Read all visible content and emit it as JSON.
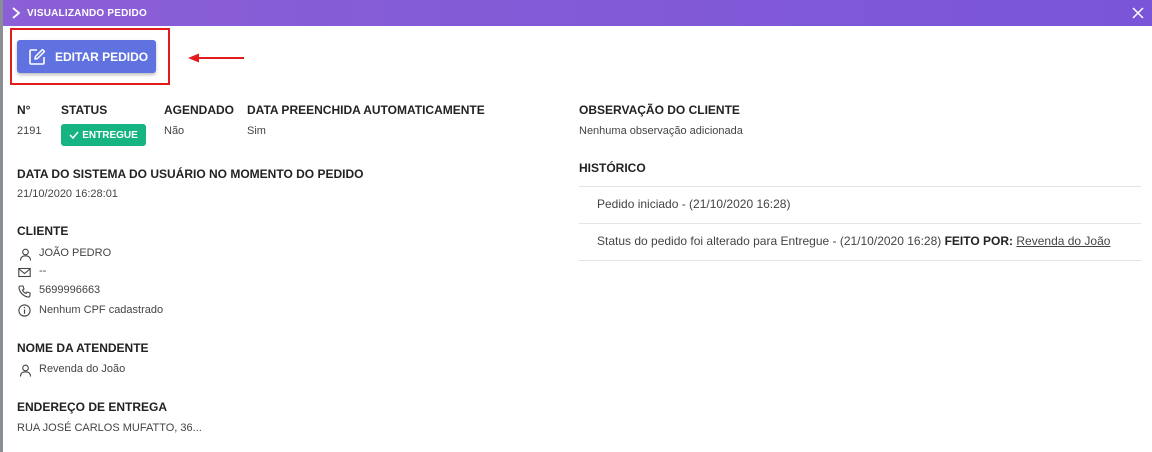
{
  "header": {
    "title": "VISUALIZANDO PEDIDO"
  },
  "toolbar": {
    "edit_label": "EDITAR PEDIDO"
  },
  "order": {
    "number_label": "N°",
    "number": "2191",
    "status_label": "STATUS",
    "status": "ENTREGUE",
    "scheduled_label": "AGENDADO",
    "scheduled": "Não",
    "autofill_label": "DATA PREENCHIDA AUTOMATICAMENTE",
    "autofill": "Sim",
    "system_date_label": "DATA DO SISTEMA DO USUÁRIO NO MOMENTO DO PEDIDO",
    "system_date": "21/10/2020 16:28:01"
  },
  "client": {
    "label": "CLIENTE",
    "name": "JOÃO PEDRO",
    "email": "--",
    "phone": "5699996663",
    "cpf": "Nenhum CPF cadastrado"
  },
  "attendant": {
    "label": "NOME DA ATENDENTE",
    "name": "Revenda do João"
  },
  "delivery": {
    "label": "ENDEREÇO DE ENTREGA",
    "address": "RUA JOSÉ CARLOS MUFATTO, 36..."
  },
  "observation": {
    "label": "OBSERVAÇÃO DO CLIENTE",
    "text": "Nenhuma observação adicionada"
  },
  "history": {
    "label": "HISTÓRICO",
    "items": [
      {
        "text": "Pedido iniciado - (21/10/2020 16:28)"
      },
      {
        "text": "Status do pedido foi alterado para Entregue - (21/10/2020 16:28) ",
        "by_label": "FEITO POR:",
        "by": "Revenda do João"
      }
    ]
  },
  "colors": {
    "header": "#7a55d8",
    "button": "#5f72e0",
    "status": "#16b482",
    "highlight": "#e21b1b"
  }
}
